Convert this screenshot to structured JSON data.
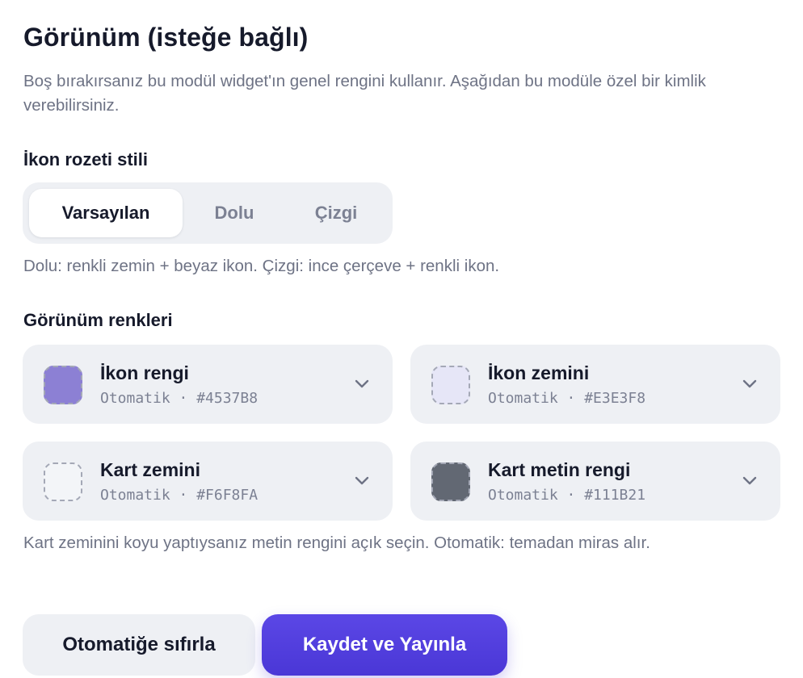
{
  "section": {
    "title": "Görünüm (isteğe bağlı)",
    "description": "Boş bırakırsanız bu modül widget'ın genel rengini kullanır. Aşağıdan bu modüle özel bir kimlik verebilirsiniz."
  },
  "badge_style": {
    "label": "İkon rozeti stili",
    "options": [
      "Varsayılan",
      "Dolu",
      "Çizgi"
    ],
    "selected": "Varsayılan",
    "hint": "Dolu: renkli zemin + beyaz ikon. Çizgi: ince çerçeve + renkli ikon."
  },
  "appearance_colors": {
    "label": "Görünüm renkleri",
    "items": [
      {
        "title": "İkon rengi",
        "subtitle": "Otomatik · #4537B8",
        "swatch": "#8c80d4",
        "icon": "chevron-down-icon"
      },
      {
        "title": "İkon zemini",
        "subtitle": "Otomatik · #E3E3F8",
        "swatch": "#e6e6f7",
        "icon": "chevron-down-icon"
      },
      {
        "title": "Kart zemini",
        "subtitle": "Otomatik · #F6F8FA",
        "swatch": "#f3f5f8",
        "icon": "chevron-down-icon"
      },
      {
        "title": "Kart metin rengi",
        "subtitle": "Otomatik · #111B21",
        "swatch": "#626873",
        "icon": "chevron-down-icon"
      }
    ],
    "hint": "Kart zeminini koyu yaptıysanız metin rengini açık seçin. Otomatik: temadan miras alır."
  },
  "actions": {
    "reset_label": "Otomatiğe sıfırla",
    "save_label": "Kaydet ve Yayınla"
  },
  "colors": {
    "accent": "#4a37d6",
    "surface": "#eef0f4",
    "text": "#161a2b",
    "muted": "#6e7385"
  }
}
